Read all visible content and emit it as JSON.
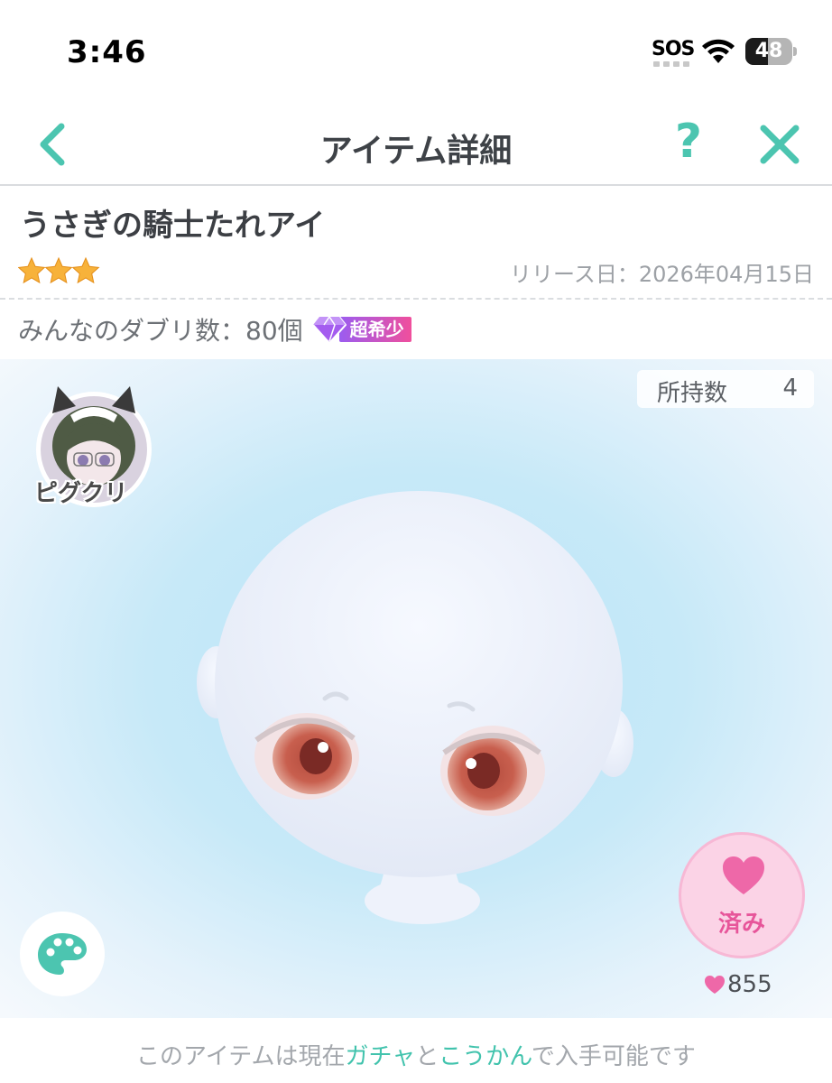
{
  "status_bar": {
    "time": "3:46",
    "carrier": "SOS",
    "battery": "48",
    "battery_level": 0.48
  },
  "header": {
    "title": "アイテム詳細",
    "help_label": "?"
  },
  "item": {
    "name": "うさぎの騎士たれアイ",
    "stars": 3,
    "release": "リリース日：2026年04月15日",
    "duplicates": "みんなのダブリ数：80個",
    "rarity": "超希少"
  },
  "preview": {
    "own_label": "所持数",
    "own_value": "4",
    "creator": "ピグクリ"
  },
  "like": {
    "label": "済み",
    "count": "855"
  },
  "footer": {
    "pre": "このアイテムは現在",
    "link1": "ガチャ",
    "mid": "と",
    "link2": "こうかん",
    "post": "で入手可能です"
  },
  "colors": {
    "accent": "#4cc5b0",
    "like_pink": "#e7559a",
    "rarity_start": "#9b5cf0",
    "rarity_end": "#f04f9c"
  }
}
